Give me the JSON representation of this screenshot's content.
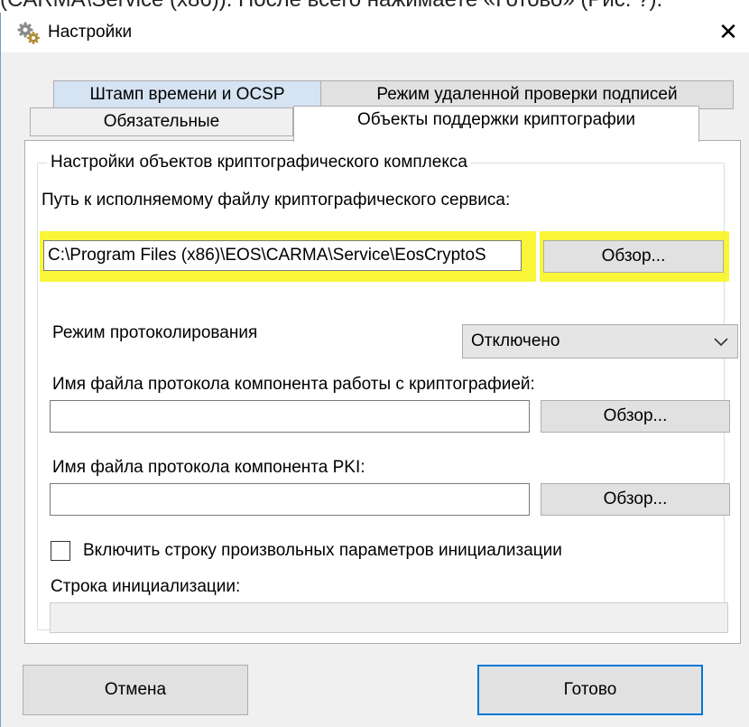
{
  "document": {
    "visible_line": "(CARMA\\Service (x86)). После всего нажимаете «Готово» (Рис. ?)."
  },
  "window": {
    "title": "Настройки",
    "close_glyph": "✕"
  },
  "tabs": {
    "row1": [
      {
        "label": "Штамп времени и OCSP"
      },
      {
        "label": "Режим удаленной проверки подписей"
      }
    ],
    "row2": [
      {
        "label": "Обязательные"
      },
      {
        "label": "Объекты поддержки криптографии",
        "active": true
      }
    ]
  },
  "group": {
    "legend": "Настройки объектов криптографического комплекса",
    "service_path_label": "Путь к исполняемому файлу криптографического сервиса:",
    "service_path_value": "C:\\Program Files (x86)\\EOS\\CARMA\\Service\\EosCryptoS",
    "browse_label": "Обзор...",
    "logging_mode_label": "Режим протоколирования",
    "logging_mode_value": "Отключено",
    "crypto_log_label": "Имя файла протокола компонента работы с криптографией:",
    "crypto_log_value": "",
    "pki_log_label": "Имя файла протокола компонента PKI:",
    "pki_log_value": "",
    "init_checkbox_label": "Включить строку произвольных параметров инициализации",
    "init_checkbox_checked": false,
    "init_string_label": "Строка инициализации:",
    "init_string_value": ""
  },
  "footer": {
    "cancel_label": "Отмена",
    "ok_label": "Готово"
  },
  "colors": {
    "highlight": "#f7f300",
    "focus_border": "#0078d7",
    "window_bg": "#f0f0f0"
  },
  "icons": [
    "gear-icon",
    "close-icon",
    "chevron-down-icon"
  ]
}
